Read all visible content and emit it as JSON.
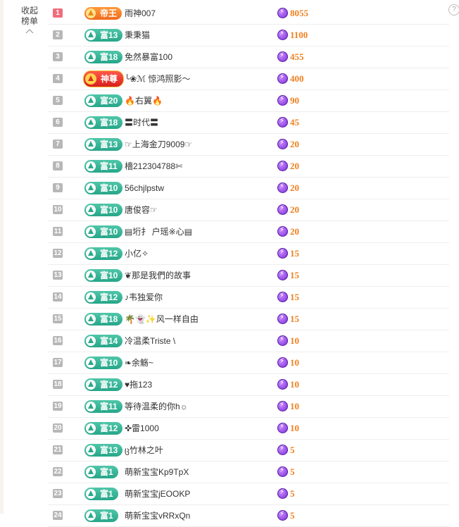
{
  "collapse": {
    "label": "收起榜单"
  },
  "help": {
    "label": "?"
  },
  "rows": [
    {
      "rank": "1",
      "badge": "帝王",
      "name": "雨神007",
      "score": "8055"
    },
    {
      "rank": "2",
      "badge": "富13",
      "name": "秉秉猫",
      "score": "1100"
    },
    {
      "rank": "3",
      "badge": "富18",
      "name": "免然暴富100",
      "score": "455"
    },
    {
      "rank": "4",
      "badge": "神尊",
      "name": "╰❀ℳ 惊鸿照影～",
      "score": "400"
    },
    {
      "rank": "5",
      "badge": "富20",
      "name": "🔥右翼🔥",
      "score": "90"
    },
    {
      "rank": "6",
      "badge": "富18",
      "name": "〓时代〓",
      "score": "45"
    },
    {
      "rank": "7",
      "badge": "富13",
      "name": "☞上海金刀9009☞",
      "score": "20"
    },
    {
      "rank": "8",
      "badge": "富11",
      "name": "檣212304788✄",
      "score": "20"
    },
    {
      "rank": "9",
      "badge": "富10",
      "name": "56chjlpstw",
      "score": "20"
    },
    {
      "rank": "10",
      "badge": "富10",
      "name": "唐俊容☞",
      "score": "20"
    },
    {
      "rank": "11",
      "badge": "富10",
      "name": "▤垳扌 户瑶※心▤",
      "score": "20"
    },
    {
      "rank": "12",
      "badge": "富12",
      "name": "小亿✧",
      "score": "15"
    },
    {
      "rank": "13",
      "badge": "富10",
      "name": "❦那是我們的故事",
      "score": "15"
    },
    {
      "rank": "14",
      "badge": "富12",
      "name": "♪韦独爱你",
      "score": "15"
    },
    {
      "rank": "15",
      "badge": "富18",
      "name": "🌴👻✨风一样自由",
      "score": "15"
    },
    {
      "rank": "16",
      "badge": "富14",
      "name": "冷温柔Triste \\",
      "score": "10"
    },
    {
      "rank": "17",
      "badge": "富10",
      "name": "❧余觞~",
      "score": "10"
    },
    {
      "rank": "18",
      "badge": "富12",
      "name": "♥拖123",
      "score": "10"
    },
    {
      "rank": "19",
      "badge": "富11",
      "name": "等待温柔的你h☼",
      "score": "10"
    },
    {
      "rank": "20",
      "badge": "富12",
      "name": "✜雷1000",
      "score": "10"
    },
    {
      "rank": "21",
      "badge": "富13",
      "name": "ც竹林之叶",
      "score": "5"
    },
    {
      "rank": "22",
      "badge": "富1",
      "name": "萌新宝宝Kp9TpX",
      "score": "5"
    },
    {
      "rank": "23",
      "badge": "富1",
      "name": "萌新宝宝jEOOKP",
      "score": "5"
    },
    {
      "rank": "24",
      "badge": "富1",
      "name": "萌新宝宝vRRxQn",
      "score": "5"
    }
  ]
}
